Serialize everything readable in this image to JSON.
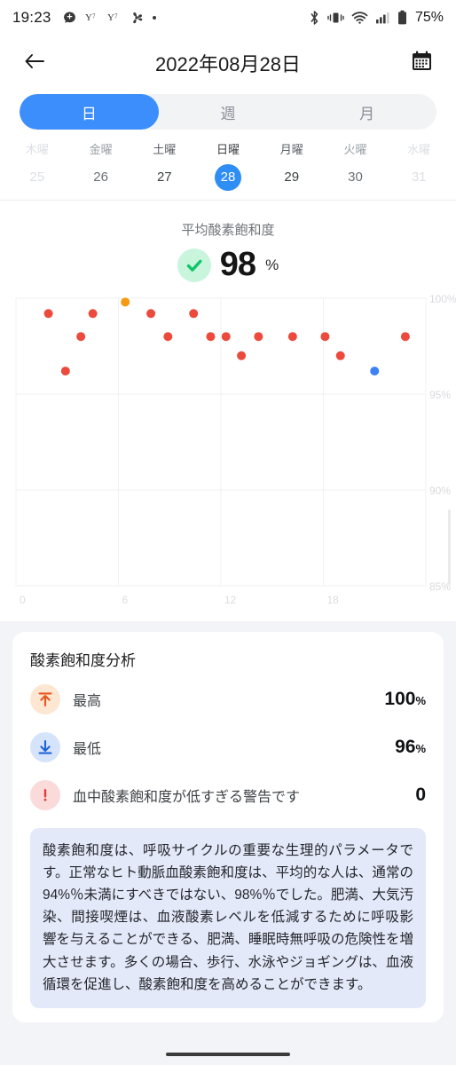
{
  "statusbar": {
    "time": "19:23",
    "left_icons": [
      "app-badge-icon",
      "yahoo-icon-1",
      "yahoo-icon-2",
      "fan-icon",
      "dot-icon"
    ],
    "right_icons": [
      "bluetooth-icon",
      "vibrate-icon",
      "wifi-icon",
      "signal-icon",
      "battery-icon"
    ],
    "battery_text": "75%"
  },
  "header": {
    "back_icon": "back-arrow-icon",
    "title": "2022年08月28日",
    "calendar_icon": "calendar-icon"
  },
  "segment": {
    "items": [
      {
        "label": "日",
        "active": true
      },
      {
        "label": "週",
        "active": false
      },
      {
        "label": "月",
        "active": false
      }
    ]
  },
  "week": {
    "days": [
      {
        "name": "木曜",
        "num": "25",
        "state": "faded"
      },
      {
        "name": "金曜",
        "num": "26",
        "state": "normal"
      },
      {
        "name": "土曜",
        "num": "27",
        "state": "dark"
      },
      {
        "name": "日曜",
        "num": "28",
        "state": "selected"
      },
      {
        "name": "月曜",
        "num": "29",
        "state": "dark"
      },
      {
        "name": "火曜",
        "num": "30",
        "state": "normal"
      },
      {
        "name": "水曜",
        "num": "31",
        "state": "faded"
      }
    ]
  },
  "average": {
    "label": "平均酸素飽和度",
    "status_icon": "check-circle-icon",
    "value": "98",
    "unit": "%"
  },
  "chart_data": {
    "type": "scatter",
    "title": "",
    "xlabel": "",
    "ylabel": "",
    "xlim": [
      0,
      24
    ],
    "ylim": [
      85,
      100
    ],
    "x_ticks": [
      "0",
      "6",
      "12",
      "18"
    ],
    "x_tick_values": [
      0,
      6,
      12,
      18
    ],
    "y_ticks": [
      "100%",
      "95%",
      "90%",
      "85%"
    ],
    "y_tick_values": [
      100,
      95,
      90,
      85
    ],
    "grid": true,
    "legend": null,
    "point_colors": {
      "normal": "#ec4a3c",
      "high": "#f59b13",
      "low": "#3b82f6"
    },
    "points": [
      {
        "x": 1.9,
        "y": 99.2,
        "kind": "normal"
      },
      {
        "x": 3.8,
        "y": 98.0,
        "kind": "normal"
      },
      {
        "x": 4.5,
        "y": 99.2,
        "kind": "normal"
      },
      {
        "x": 2.9,
        "y": 96.2,
        "kind": "normal"
      },
      {
        "x": 6.4,
        "y": 99.8,
        "kind": "high"
      },
      {
        "x": 7.9,
        "y": 99.2,
        "kind": "normal"
      },
      {
        "x": 8.9,
        "y": 98.0,
        "kind": "normal"
      },
      {
        "x": 10.4,
        "y": 99.2,
        "kind": "normal"
      },
      {
        "x": 11.4,
        "y": 98.0,
        "kind": "normal"
      },
      {
        "x": 12.3,
        "y": 98.0,
        "kind": "normal"
      },
      {
        "x": 13.2,
        "y": 97.0,
        "kind": "normal"
      },
      {
        "x": 14.2,
        "y": 98.0,
        "kind": "normal"
      },
      {
        "x": 16.2,
        "y": 98.0,
        "kind": "normal"
      },
      {
        "x": 18.1,
        "y": 98.0,
        "kind": "normal"
      },
      {
        "x": 19.0,
        "y": 97.0,
        "kind": "normal"
      },
      {
        "x": 21.0,
        "y": 96.2,
        "kind": "low"
      },
      {
        "x": 22.8,
        "y": 98.0,
        "kind": "normal"
      }
    ]
  },
  "analysis": {
    "title": "酸素飽和度分析",
    "rows": [
      {
        "icon": "arrow-up-to-line-icon",
        "icon_kind": "up",
        "label": "最高",
        "value": "100",
        "unit": "%"
      },
      {
        "icon": "arrow-down-to-line-icon",
        "icon_kind": "down",
        "label": "最低",
        "value": "96",
        "unit": "%"
      },
      {
        "icon": "exclamation-icon",
        "icon_kind": "warn",
        "label": "血中酸素飽和度が低すぎる警告です",
        "value": "0",
        "unit": ""
      }
    ],
    "note": "酸素飽和度は、呼吸サイクルの重要な生理的パラメータです。正常なヒト動脈血酸素飽和度は、平均的な人は、通常の94%％未満にすべきではない、98%％でした。肥満、大気汚染、間接喫煙は、血液酸素レベルを低減するために呼吸影響を与えることができる、肥満、睡眠時無呼吸の危険性を増大させます。多くの場合、歩行、水泳やジョギングは、血液循環を促進し、酸素飽和度を高めることができます。"
  },
  "colors": {
    "accent": "#3c8efc",
    "selected_day": "#2f8ef4",
    "check_green": "#14c46a",
    "note_bg": "#e4e9fa"
  }
}
